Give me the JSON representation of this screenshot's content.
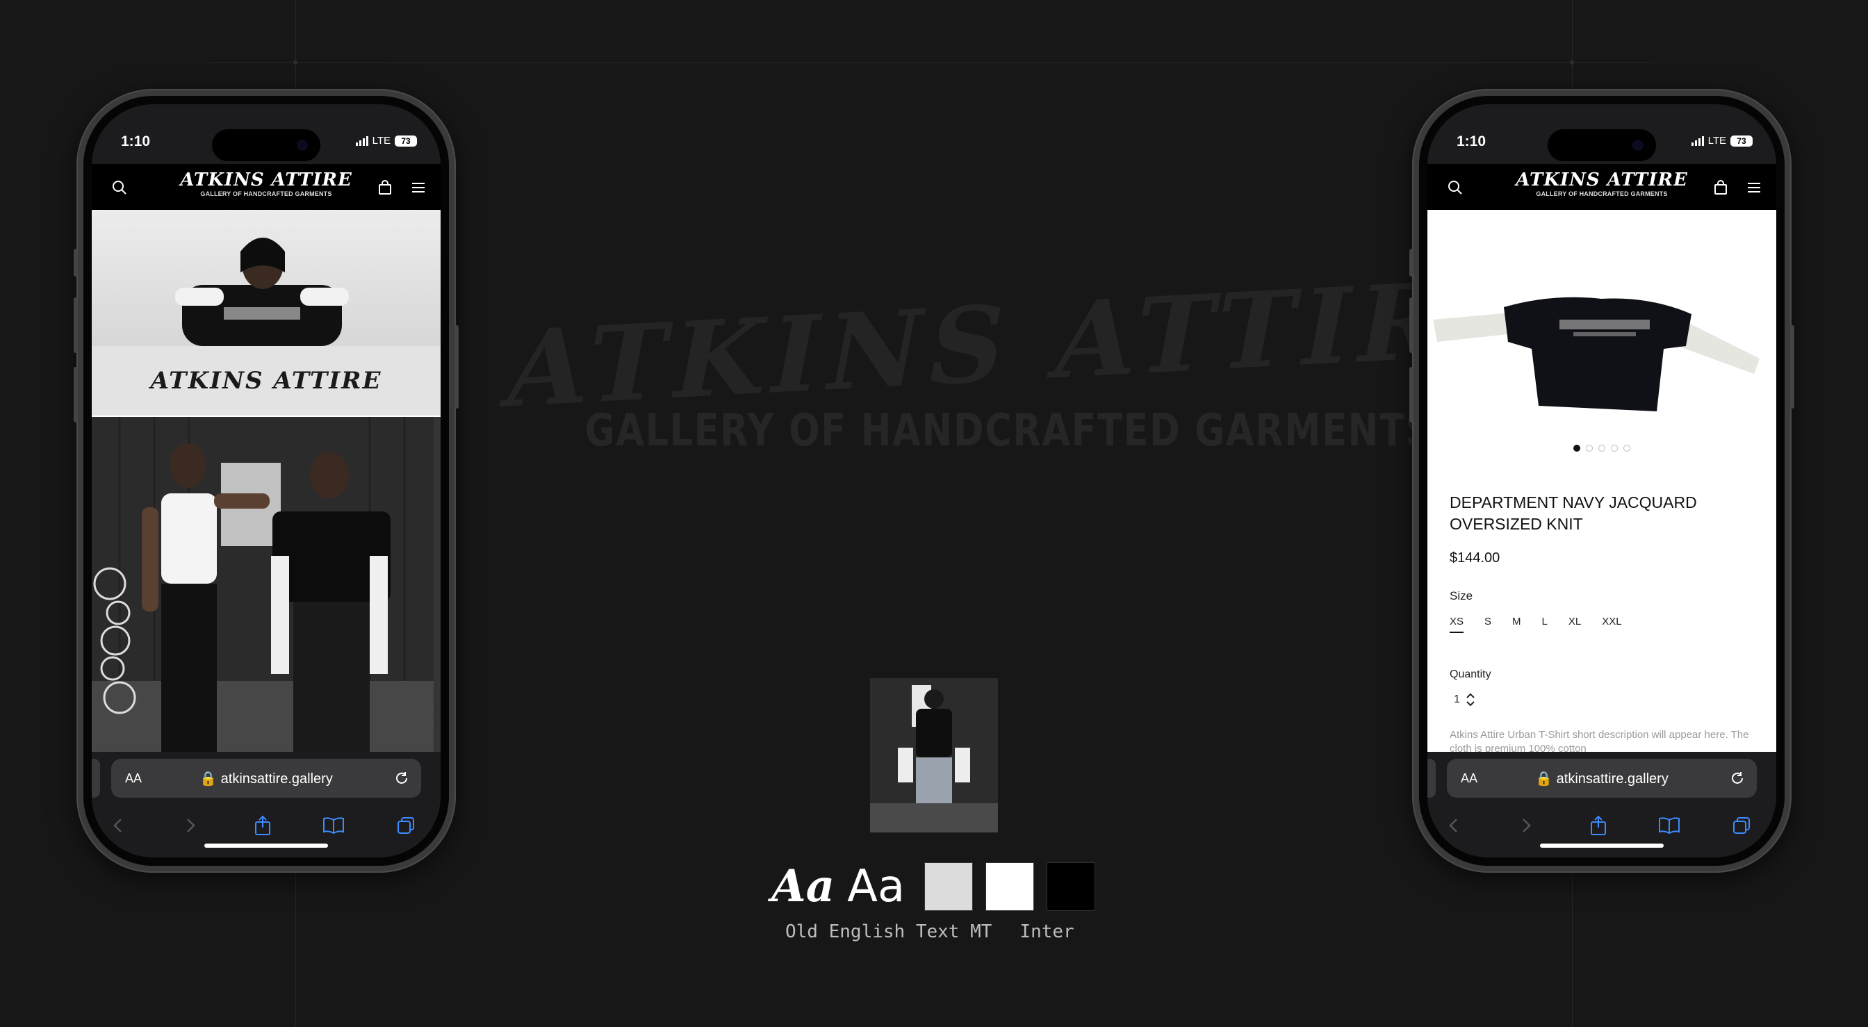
{
  "presentation": {
    "watermark_brand": "ATKINS ATTIRE",
    "watermark_tagline": "GALLERY OF HANDCRAFTED GARMENTS",
    "typography": {
      "display_sample": "Aa",
      "body_sample": "Aa",
      "display_font_name": "Old English Text MT",
      "body_font_name": "Inter"
    },
    "palette": [
      "#dcdcdc",
      "#ffffff",
      "#000000"
    ]
  },
  "phones": {
    "left": {
      "status": {
        "time": "1:10",
        "network": "LTE",
        "battery": "73"
      },
      "header": {
        "brand": "ATKINS ATTIRE",
        "tagline": "GALLERY OF HANDCRAFTED GARMENTS"
      },
      "banner_text": "ATKINS ATTIRE",
      "browser": {
        "aa_label": "AA",
        "url": "atkinsattire.gallery"
      }
    },
    "right": {
      "status": {
        "time": "1:10",
        "network": "LTE",
        "battery": "73"
      },
      "header": {
        "brand": "ATKINS ATTIRE",
        "tagline": "GALLERY OF HANDCRAFTED GARMENTS"
      },
      "product": {
        "title": "DEPARTMENT NAVY JACQUARD OVERSIZED KNIT",
        "price": "$144.00",
        "size_label": "Size",
        "sizes": [
          "XS",
          "S",
          "M",
          "L",
          "XL",
          "XXL"
        ],
        "selected_size": "XS",
        "quantity_label": "Quantity",
        "quantity": "1",
        "image_count": 5,
        "active_image": 1,
        "description": "Atkins Attire Urban T-Shirt short description will appear here. The cloth is premium 100% cotton"
      },
      "browser": {
        "aa_label": "AA",
        "url": "atkinsattire.gallery"
      }
    }
  }
}
